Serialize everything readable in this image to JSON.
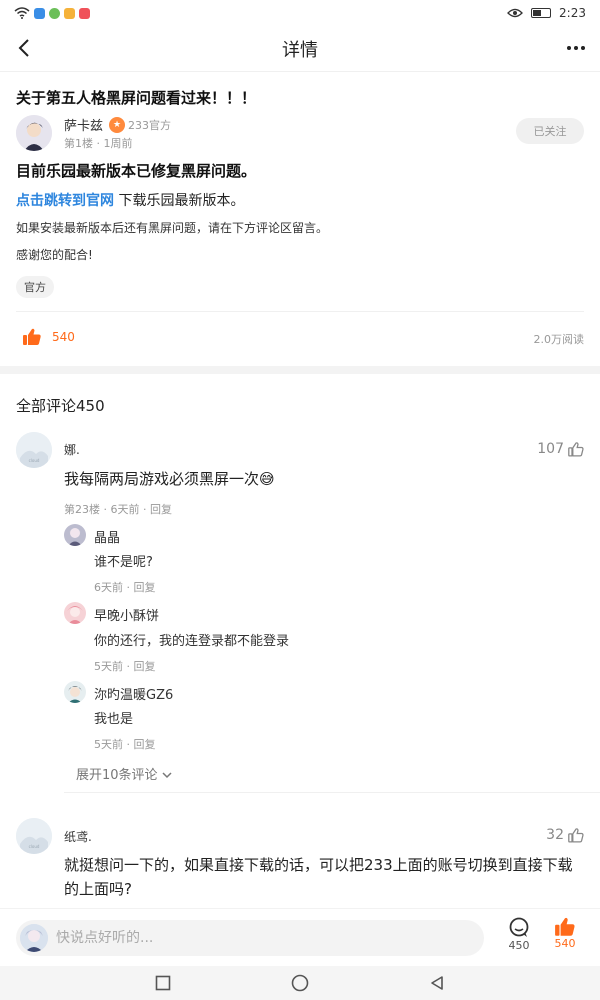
{
  "status_bar": {
    "time": "2:23"
  },
  "header": {
    "title": "详情"
  },
  "post": {
    "title": "关于第五人格黑屏问题看过来！！！",
    "author_name": "萨卡兹",
    "author_badge": "233官方",
    "author_meta": "第1楼 · 1周前",
    "follow_label": "已关注",
    "headline": "目前乐园最新版本已修复黑屏问题。",
    "link_text": "点击跳转到官网",
    "link_suffix": " 下载乐园最新版本。",
    "body1": "如果安装最新版本后还有黑屏问题，请在下方评论区留言。",
    "body2": "感谢您的配合!",
    "tag": "官方",
    "likes": "540",
    "reads": "2.0万阅读"
  },
  "comments_header": "全部评论450",
  "comments": [
    {
      "name": "娜.",
      "likes": "107",
      "text": "我每隔两局游戏必须黑屏一次😅",
      "meta": "第23楼 · 6天前 · 回复",
      "replies": [
        {
          "name": "晶晶",
          "text": "谁不是呢?",
          "meta": "6天前 · 回复"
        },
        {
          "name": "早晚小酥饼",
          "text": "你的还行，我的连登录都不能登录",
          "meta": "5天前 · 回复"
        },
        {
          "name": "沵旳温暖GZ6",
          "text": "我也是",
          "meta": "5天前 · 回复"
        }
      ],
      "expand_label": "展开10条评论"
    },
    {
      "name": "纸鸢.",
      "likes": "32",
      "text": "就挺想问一下的，如果直接下载的话，可以把233上面的账号切换到直接下载的上面吗?"
    }
  ],
  "bottom_bar": {
    "input_placeholder": "快说点好听的...",
    "comment_count": "450",
    "like_count": "540"
  },
  "colors": {
    "accent": "#ff6a1a",
    "link": "#2e86de"
  }
}
